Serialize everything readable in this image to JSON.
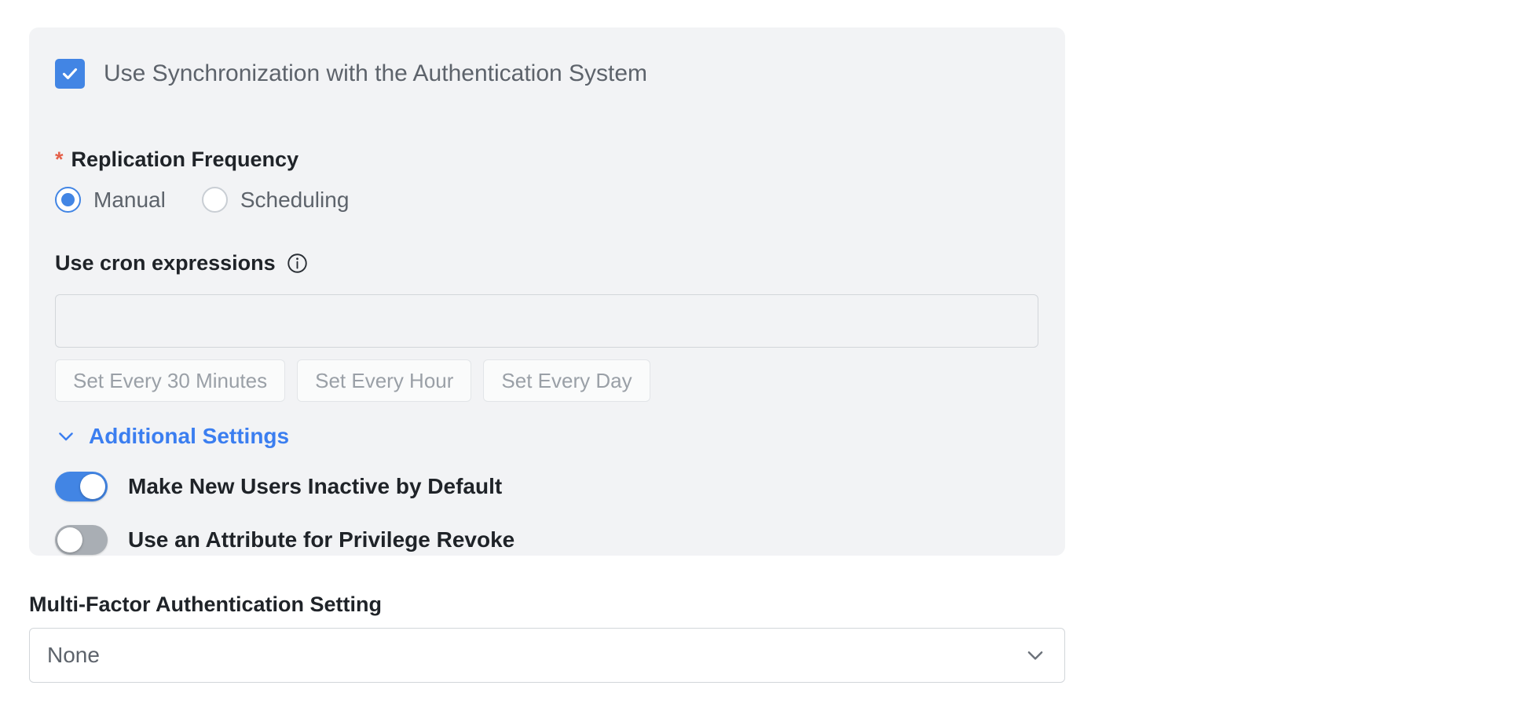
{
  "sync_panel": {
    "use_sync_checkbox": {
      "label": "Use Synchronization with the Authentication System",
      "checked": true,
      "icon": "check-icon",
      "color": "#4285e4"
    },
    "replication_frequency": {
      "required_marker": "*",
      "label": "Replication Frequency",
      "required_color": "#e4604a",
      "options": [
        {
          "label": "Manual",
          "selected": true
        },
        {
          "label": "Scheduling",
          "selected": false
        }
      ]
    },
    "cron": {
      "label": "Use cron expressions",
      "info_icon": "info-circle-icon",
      "input_value": "",
      "input_placeholder": "",
      "presets": [
        "Set Every 30 Minutes",
        "Set Every Hour",
        "Set Every Day"
      ]
    },
    "additional_settings": {
      "label": "Additional Settings",
      "icon": "chevron-down-icon",
      "color": "#3b7ef0",
      "expanded": true,
      "toggles": [
        {
          "label": "Make New Users Inactive by Default",
          "on": true
        },
        {
          "label": "Use an Attribute for Privilege Revoke",
          "on": false
        }
      ]
    }
  },
  "mfa": {
    "label": "Multi-Factor Authentication Setting",
    "selected_value": "None",
    "icon": "chevron-down-icon"
  }
}
